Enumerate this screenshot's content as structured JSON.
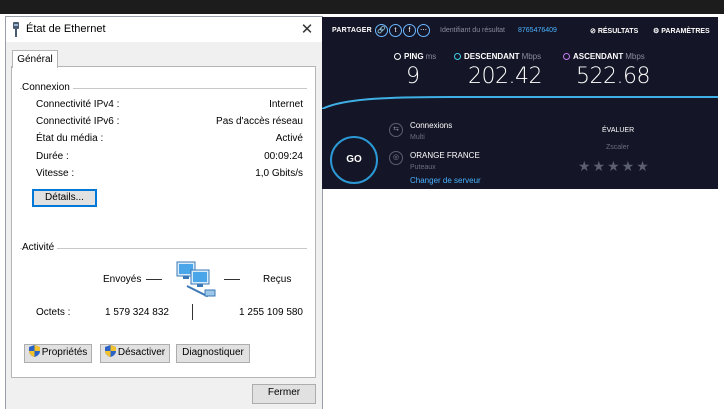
{
  "dialog": {
    "title": "État de Ethernet",
    "close_glyph": "✕",
    "tab": "Général",
    "connection": {
      "section": "Connexion",
      "rows": [
        {
          "label": "Connectivité IPv4 :",
          "value": "Internet"
        },
        {
          "label": "Connectivité IPv6 :",
          "value": "Pas d'accès réseau"
        },
        {
          "label": "État du média :",
          "value": "Activé"
        },
        {
          "label": "Durée :",
          "value": "00:09:24"
        },
        {
          "label": "Vitesse :",
          "value": "1,0 Gbits/s"
        }
      ],
      "details_button": "Détails..."
    },
    "activity": {
      "section": "Activité",
      "sent_label": "Envoyés",
      "received_label": "Reçus",
      "bytes_label": "Octets :",
      "bytes_sent": "1 579 324 832",
      "bytes_received": "1 255 109 580"
    },
    "buttons": {
      "properties": "Propriétés",
      "disable": "Désactiver",
      "diagnose": "Diagnostiquer",
      "close": "Fermer"
    }
  },
  "speedtest": {
    "share_label": "PARTAGER",
    "result_id_label": "Identifiant du résultat",
    "result_id": "8765476409",
    "results_link": "RÉSULTATS",
    "settings_link": "PARAMÈTRES",
    "ping": {
      "label": "PING",
      "unit": "ms",
      "value": "9"
    },
    "download": {
      "label": "DESCENDANT",
      "unit": "Mbps",
      "value": "202.42"
    },
    "upload": {
      "label": "ASCENDANT",
      "unit": "Mbps",
      "value": "522.68"
    },
    "go_label": "GO",
    "connections_label": "Connexions",
    "connections_mode": "Multi",
    "isp_name": "ORANGE FRANCE",
    "server_location": "Puteaux",
    "change_server": "Changer de serveur",
    "rate_label": "ÉVALUER",
    "rate_provider": "Zscaler",
    "stars": "★★★★★"
  },
  "colors": {
    "speedtest_bg": "#141526",
    "accent_blue": "#49b2ff",
    "ping_icon": "#ffffff",
    "download_icon": "#3fd0e8",
    "upload_icon": "#c37cf0"
  }
}
